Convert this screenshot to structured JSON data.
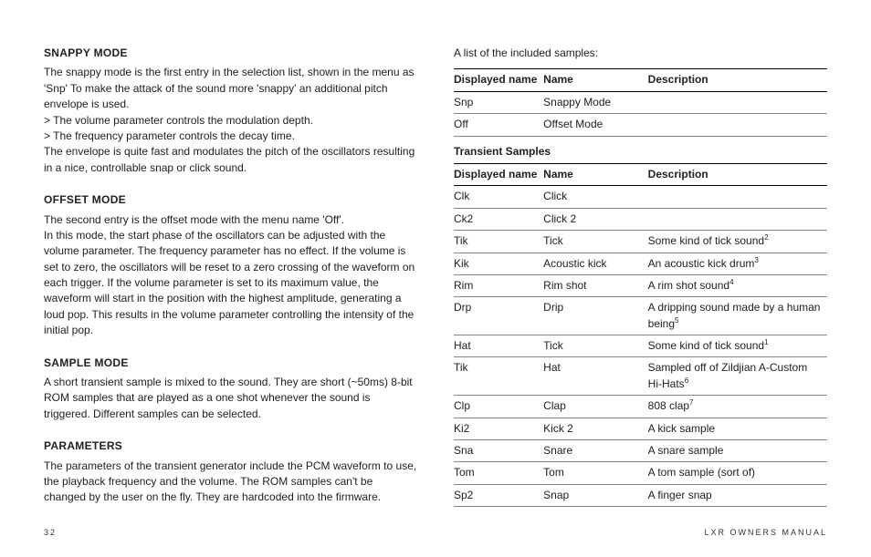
{
  "left": {
    "sections": [
      {
        "heading": "SNAPPY MODE",
        "paragraphs": [
          "The snappy mode is the first entry in the selection list, shown in the menu as 'Snp' To make the attack of the sound more 'snappy' an additional pitch envelope is used.",
          "> The volume parameter controls the modulation depth.",
          "> The frequency parameter controls the decay time.",
          "The envelope is quite fast and modulates the pitch of the oscillators resulting in a nice, controllable snap or click sound."
        ]
      },
      {
        "heading": "OFFSET MODE",
        "paragraphs": [
          "The second entry is the offset mode with the menu name 'Off'.",
          "In this mode, the start phase of the oscillators can be adjusted with the volume parameter. The frequency parameter has no effect. If the volume is set to zero, the oscillators will be reset to a zero crossing of the waveform on each trigger. If the volume parameter is set to its maximum value, the waveform will start in the position with the highest amplitude, generating a loud pop. This results in the volume parameter controlling the intensity of the initial pop."
        ]
      },
      {
        "heading": "SAMPLE MODE",
        "paragraphs": [
          "A short transient sample is mixed to the sound. They are short (~50ms) 8-bit ROM samples that are played as a one shot whenever the sound is triggered. Different samples can be selected."
        ]
      },
      {
        "heading": "PARAMETERS",
        "paragraphs": [
          "The parameters of the transient generator include the PCM waveform to use, the playback frequency and the volume. The ROM samples can't be changed by the user on the fly. They are hardcoded into the firmware."
        ]
      }
    ]
  },
  "right": {
    "intro": "A list of the included samples:",
    "table1": {
      "headers": [
        "Displayed name",
        "Name",
        "Description"
      ],
      "rows": [
        {
          "c1": "Snp",
          "c2": "Snappy Mode",
          "c3": ""
        },
        {
          "c1": "Off",
          "c2": "Offset Mode",
          "c3": ""
        }
      ]
    },
    "sub_heading": "Transient Samples",
    "table2": {
      "headers": [
        "Displayed name",
        "Name",
        "Description"
      ],
      "rows": [
        {
          "c1": "Clk",
          "c2": "Click",
          "c3": ""
        },
        {
          "c1": "Ck2",
          "c2": "Click 2",
          "c3": ""
        },
        {
          "c1": "Tik",
          "c2": "Tick",
          "c3": "Some kind of tick sound",
          "sup": "2"
        },
        {
          "c1": "Kik",
          "c2": "Acoustic kick",
          "c3": "An acoustic kick drum",
          "sup": "3"
        },
        {
          "c1": "Rim",
          "c2": "Rim shot",
          "c3": "A rim shot sound",
          "sup": "4"
        },
        {
          "c1": "Drp",
          "c2": "Drip",
          "c3": "A dripping sound made by a human being",
          "sup": "5"
        },
        {
          "c1": "Hat",
          "c2": "Tick",
          "c3": "Some kind of tick sound",
          "sup": "1"
        },
        {
          "c1": "Tik",
          "c2": "Hat",
          "c3": "Sampled off of Zildjian A-Custom Hi-Hats",
          "sup": "6"
        },
        {
          "c1": "Clp",
          "c2": "Clap",
          "c3": "808 clap",
          "sup": "7"
        },
        {
          "c1": "Ki2",
          "c2": "Kick 2",
          "c3": "A kick sample"
        },
        {
          "c1": "Sna",
          "c2": "Snare",
          "c3": "A snare sample"
        },
        {
          "c1": "Tom",
          "c2": "Tom",
          "c3": "A tom sample (sort of)"
        },
        {
          "c1": "Sp2",
          "c2": "Snap",
          "c3": "A finger snap"
        }
      ]
    }
  },
  "footer": {
    "page": "32",
    "title": "LXR OWNERS MANUAL"
  }
}
